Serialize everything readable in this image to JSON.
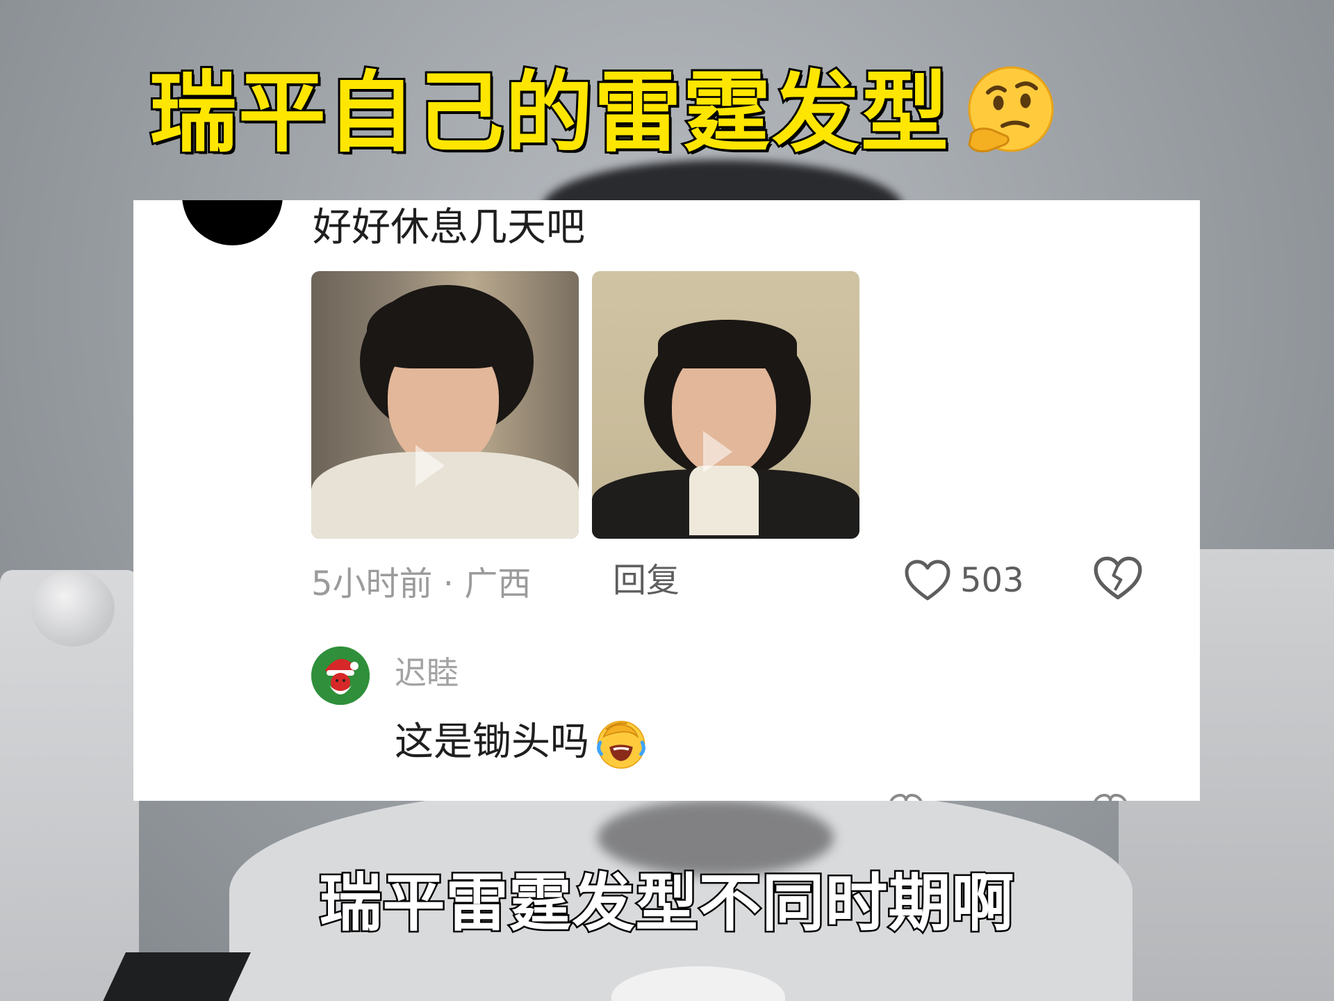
{
  "title": "瑞平自己的雷霆发型",
  "title_emoji": "thinking-face",
  "comment": {
    "text": "好好休息几天吧",
    "meta": "5小时前 · 广西",
    "reply_label": "回复",
    "like_count": "503"
  },
  "reply": {
    "username": "迟睦",
    "text": "这是锄头吗",
    "emoji": "laughing-facepalm"
  },
  "subtitle": "瑞平雷霆发型不同时期啊",
  "colors": {
    "title": "#ffe600",
    "meta_text": "#9b9b9b",
    "body_text": "#1f1f1f"
  }
}
